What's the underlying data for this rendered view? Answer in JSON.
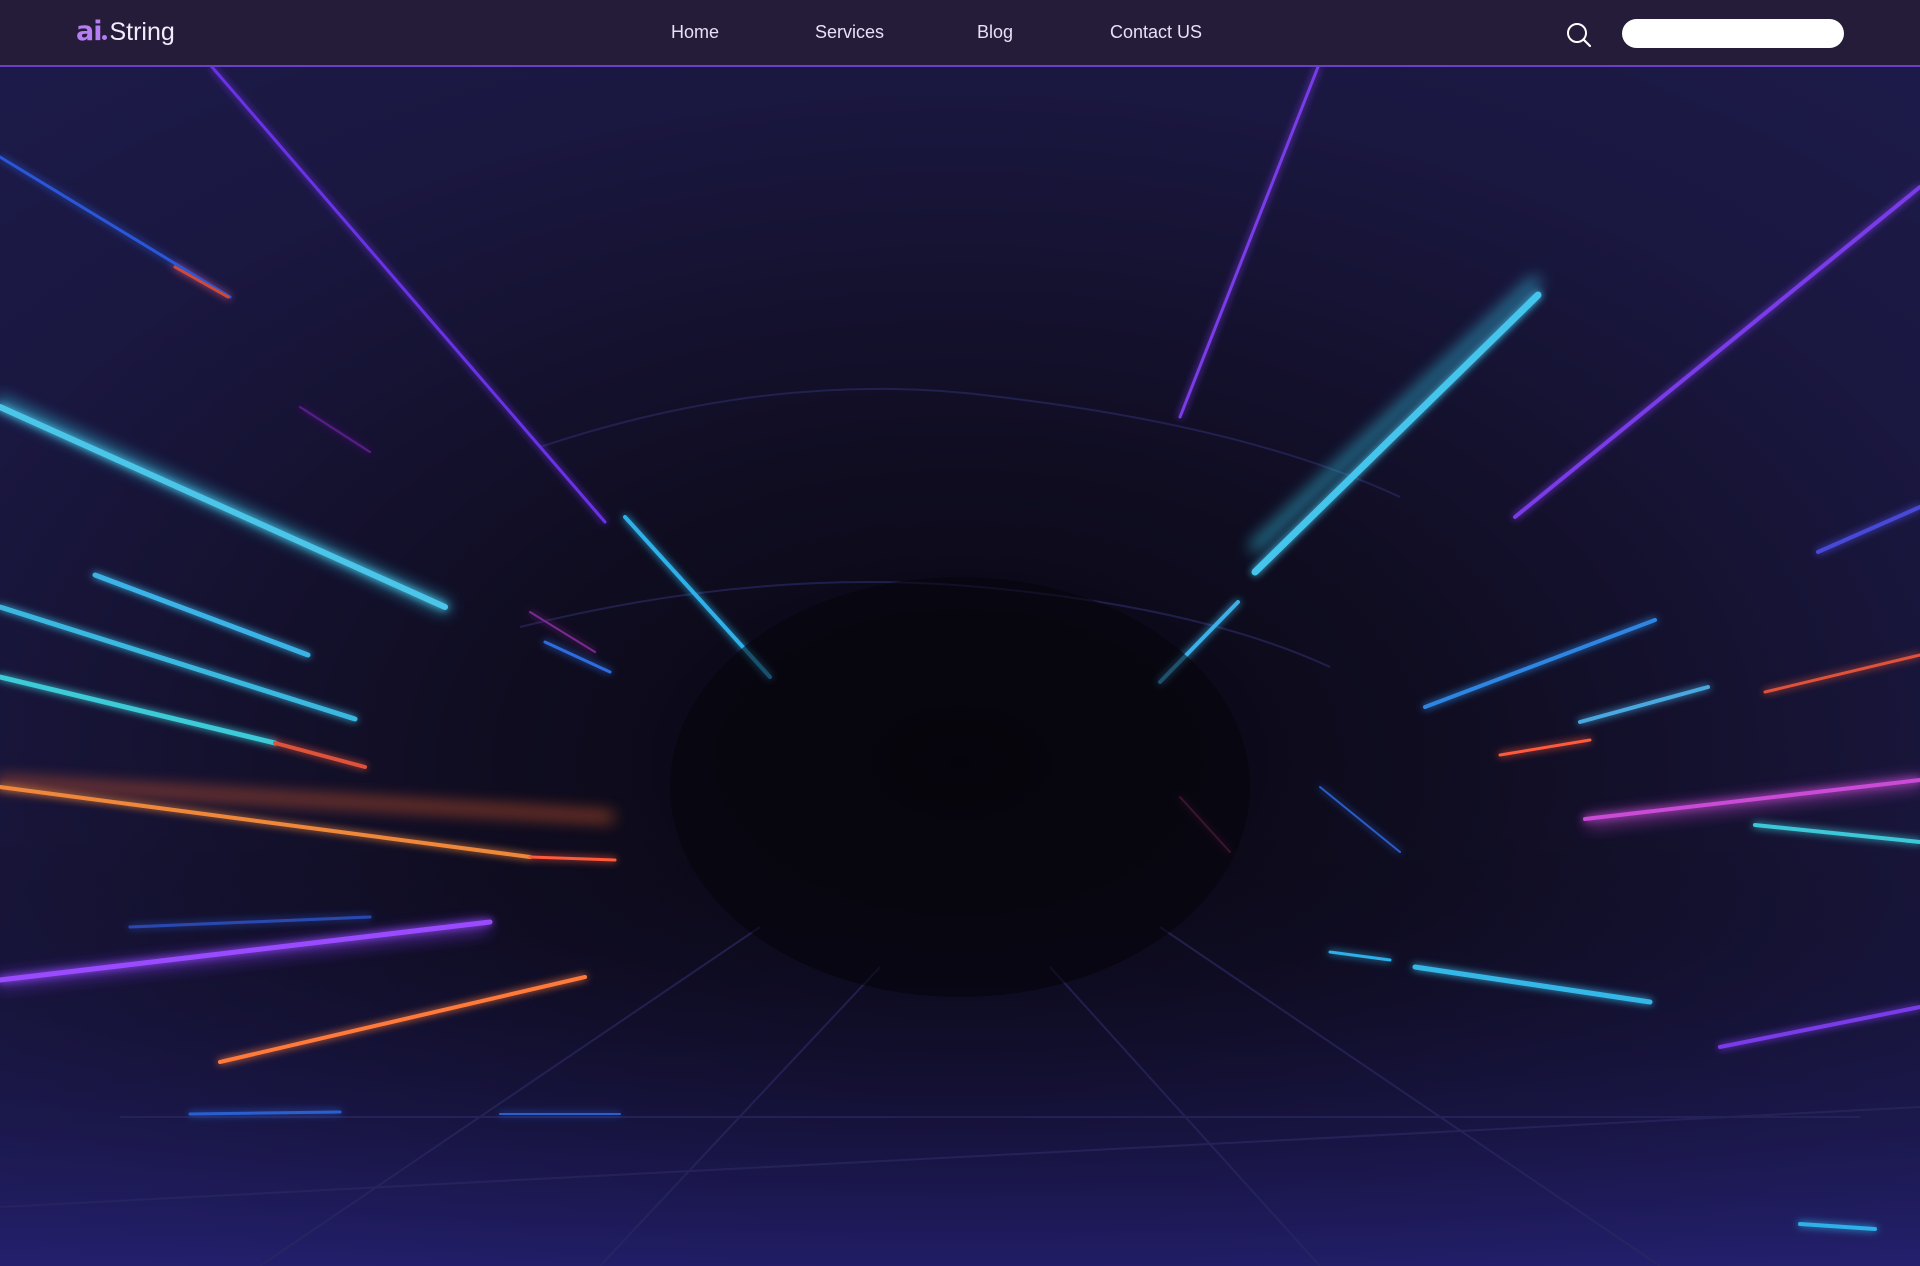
{
  "header": {
    "logo": {
      "mark": "ai",
      "word": "String"
    },
    "nav": [
      {
        "label": "Home"
      },
      {
        "label": "Services"
      },
      {
        "label": "Blog"
      },
      {
        "label": "Contact US"
      }
    ],
    "search": {
      "icon": "search-icon",
      "value": "",
      "placeholder": ""
    }
  },
  "hero": {
    "image": "neon light-streak tunnel background",
    "colors": {
      "base": "#0e0c1f",
      "cyan": "#35c8ea",
      "blue": "#2a6bff",
      "purple": "#8a3dff",
      "magenta": "#c94bd6",
      "orange": "#ff6a2e"
    }
  },
  "theme": {
    "nav_background": "#241c38",
    "nav_border": "#6a3fc9",
    "logo_accent": "#b57ef2",
    "text": "#e7e1f5"
  }
}
